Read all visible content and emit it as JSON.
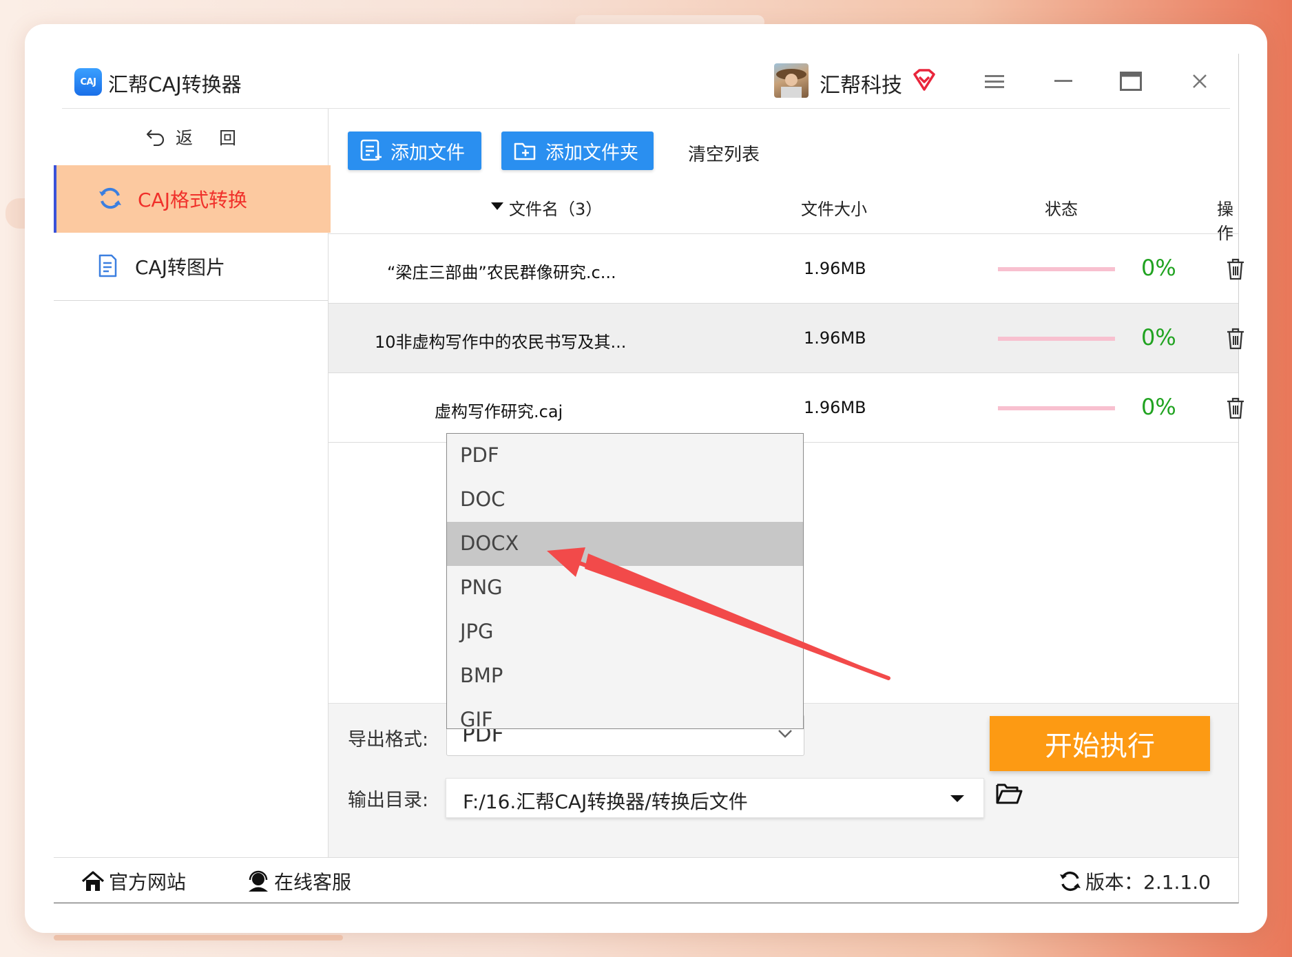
{
  "app": {
    "title": "汇帮CAJ转换器",
    "logo_text": "CAJ",
    "user_name": "汇帮科技"
  },
  "sidebar": {
    "back_label_1": "返",
    "back_label_2": "回",
    "items": [
      {
        "label": "CAJ格式转换",
        "icon": "refresh-icon",
        "active": true
      },
      {
        "label": "CAJ转图片",
        "icon": "document-icon",
        "active": false
      }
    ]
  },
  "toolbar": {
    "add_file": "添加文件",
    "add_folder": "添加文件夹",
    "clear_list": "清空列表"
  },
  "table": {
    "headers": {
      "name": "文件名（3）",
      "size": "文件大小",
      "status": "状态",
      "action": "操作"
    },
    "rows": [
      {
        "name": "“梁庄三部曲”农民群像研究.c...",
        "size": "1.96MB",
        "progress": "0%"
      },
      {
        "name": "10非虚构写作中的农民书写及其...",
        "size": "1.96MB",
        "progress": "0%"
      },
      {
        "name": "虚构写作研究.caj",
        "size": "1.96MB",
        "progress": "0%"
      }
    ]
  },
  "export": {
    "format_label": "导出格式:",
    "format_value": "PDF",
    "format_options": [
      "PDF",
      "DOC",
      "DOCX",
      "PNG",
      "JPG",
      "BMP",
      "GIF"
    ],
    "highlighted_option": "DOCX",
    "dir_label": "输出目录:",
    "dir_value": "F:/16.汇帮CAJ转换器/转换后文件",
    "start_button": "开始执行"
  },
  "footer": {
    "website": "官方网站",
    "support": "在线客服",
    "version": "版本：2.1.1.0"
  },
  "colors": {
    "accent_blue": "#2a8ff0",
    "start_orange": "#fd9a13",
    "active_nav_bg": "#fcc9a0",
    "active_nav_text": "#f0302a",
    "progress_green": "#21a321",
    "annotation_arrow": "#f24a4a"
  }
}
